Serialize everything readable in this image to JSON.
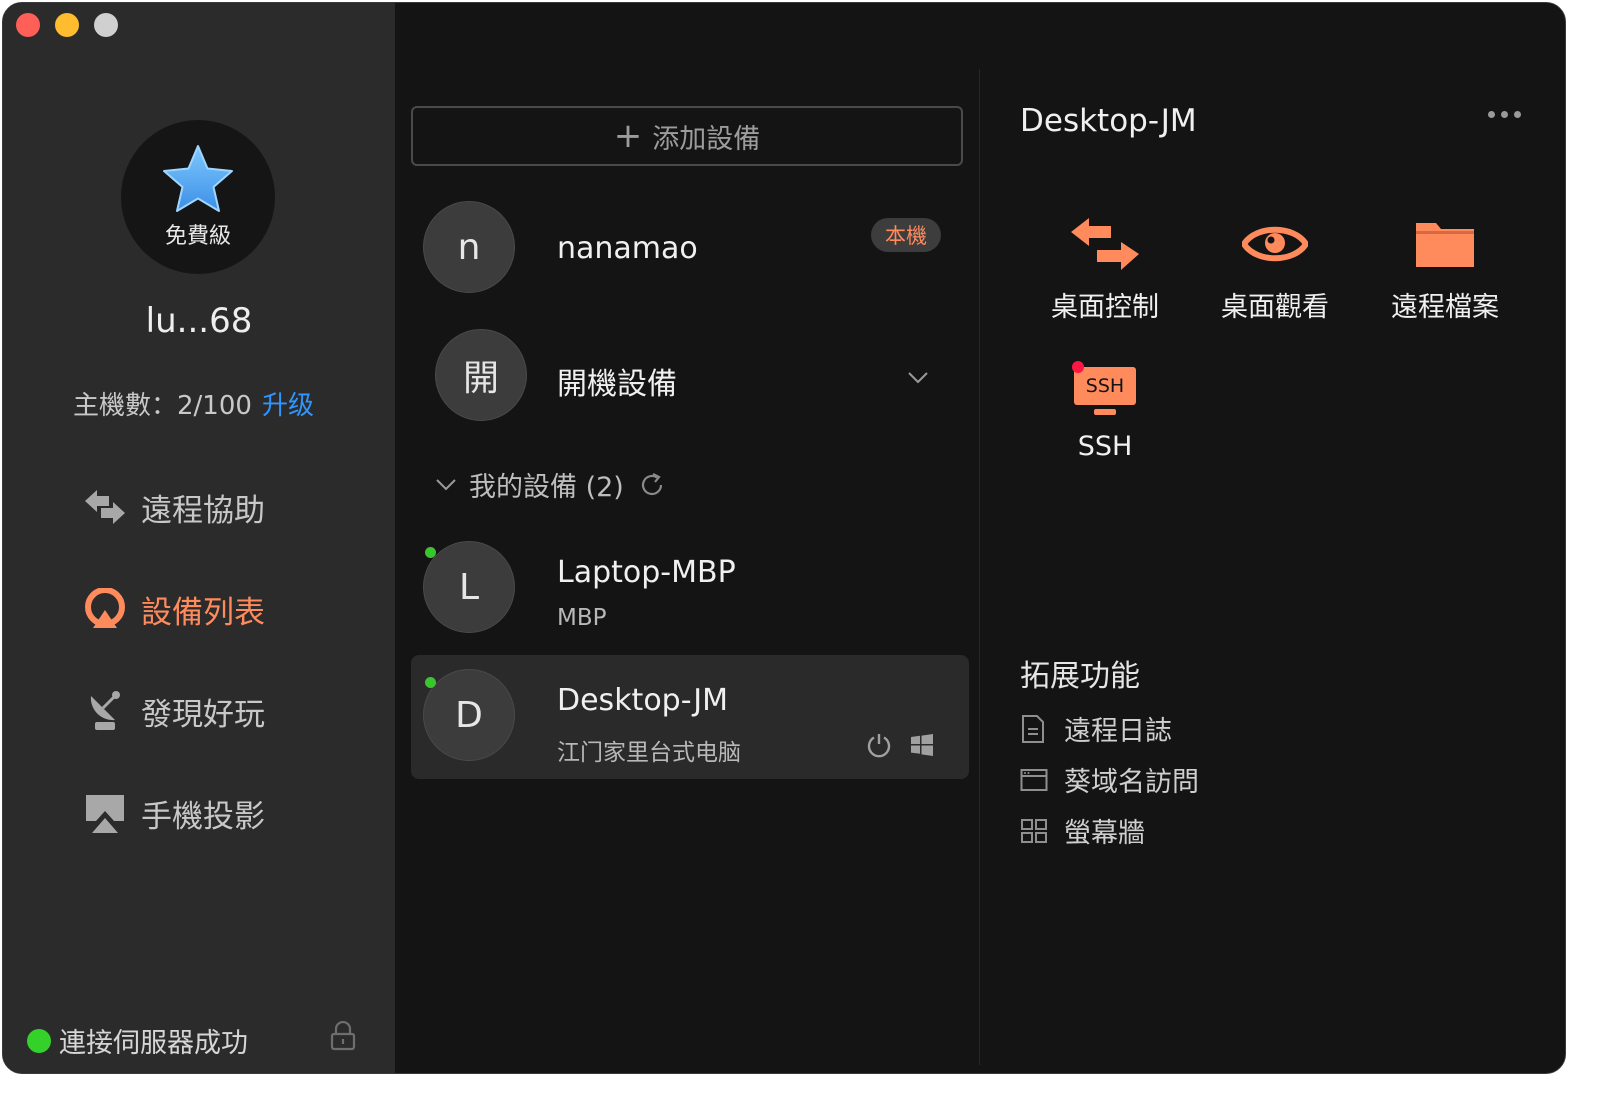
{
  "sidebar": {
    "tier_label": "免費級",
    "username": "lu...68",
    "host_count_label": "主機數：2/100",
    "upgrade_label": "升级",
    "nav": [
      {
        "label": "遠程協助",
        "icon": "remote-assist-icon",
        "active": false
      },
      {
        "label": "設備列表",
        "icon": "device-list-icon",
        "active": true
      },
      {
        "label": "發現好玩",
        "icon": "satellite-dish-icon",
        "active": false
      },
      {
        "label": "手機投影",
        "icon": "airplay-icon",
        "active": false
      }
    ],
    "status_text": "連接伺服器成功",
    "status_color": "#33d12a"
  },
  "middle": {
    "add_device_label": "添加設備",
    "local_device": {
      "initial": "n",
      "name": "nanamao",
      "badge": "本機"
    },
    "power_on_group": {
      "initial": "開",
      "name": "開機設備"
    },
    "my_devices_header": "我的設備 (2)",
    "devices": [
      {
        "initial": "L",
        "name": "Laptop-MBP",
        "sub": "MBP",
        "online": true,
        "selected": false
      },
      {
        "initial": "D",
        "name": "Desktop-JM",
        "sub": "江门家里台式电脑",
        "online": true,
        "selected": true
      }
    ]
  },
  "detail": {
    "title": "Desktop-JM",
    "actions": [
      {
        "label": "桌面控制",
        "icon": "desktop-control-icon"
      },
      {
        "label": "桌面觀看",
        "icon": "eye-icon"
      },
      {
        "label": "遠程檔案",
        "icon": "folder-icon"
      },
      {
        "label": "SSH",
        "icon": "ssh-icon",
        "icon_text": "SSH"
      }
    ],
    "extensions_title": "拓展功能",
    "extensions": [
      {
        "label": "遠程日誌",
        "icon": "document-icon"
      },
      {
        "label": "葵域名訪問",
        "icon": "browser-window-icon"
      },
      {
        "label": "螢幕牆",
        "icon": "grid-icon"
      }
    ],
    "accent_color": "#ff8a5c"
  }
}
